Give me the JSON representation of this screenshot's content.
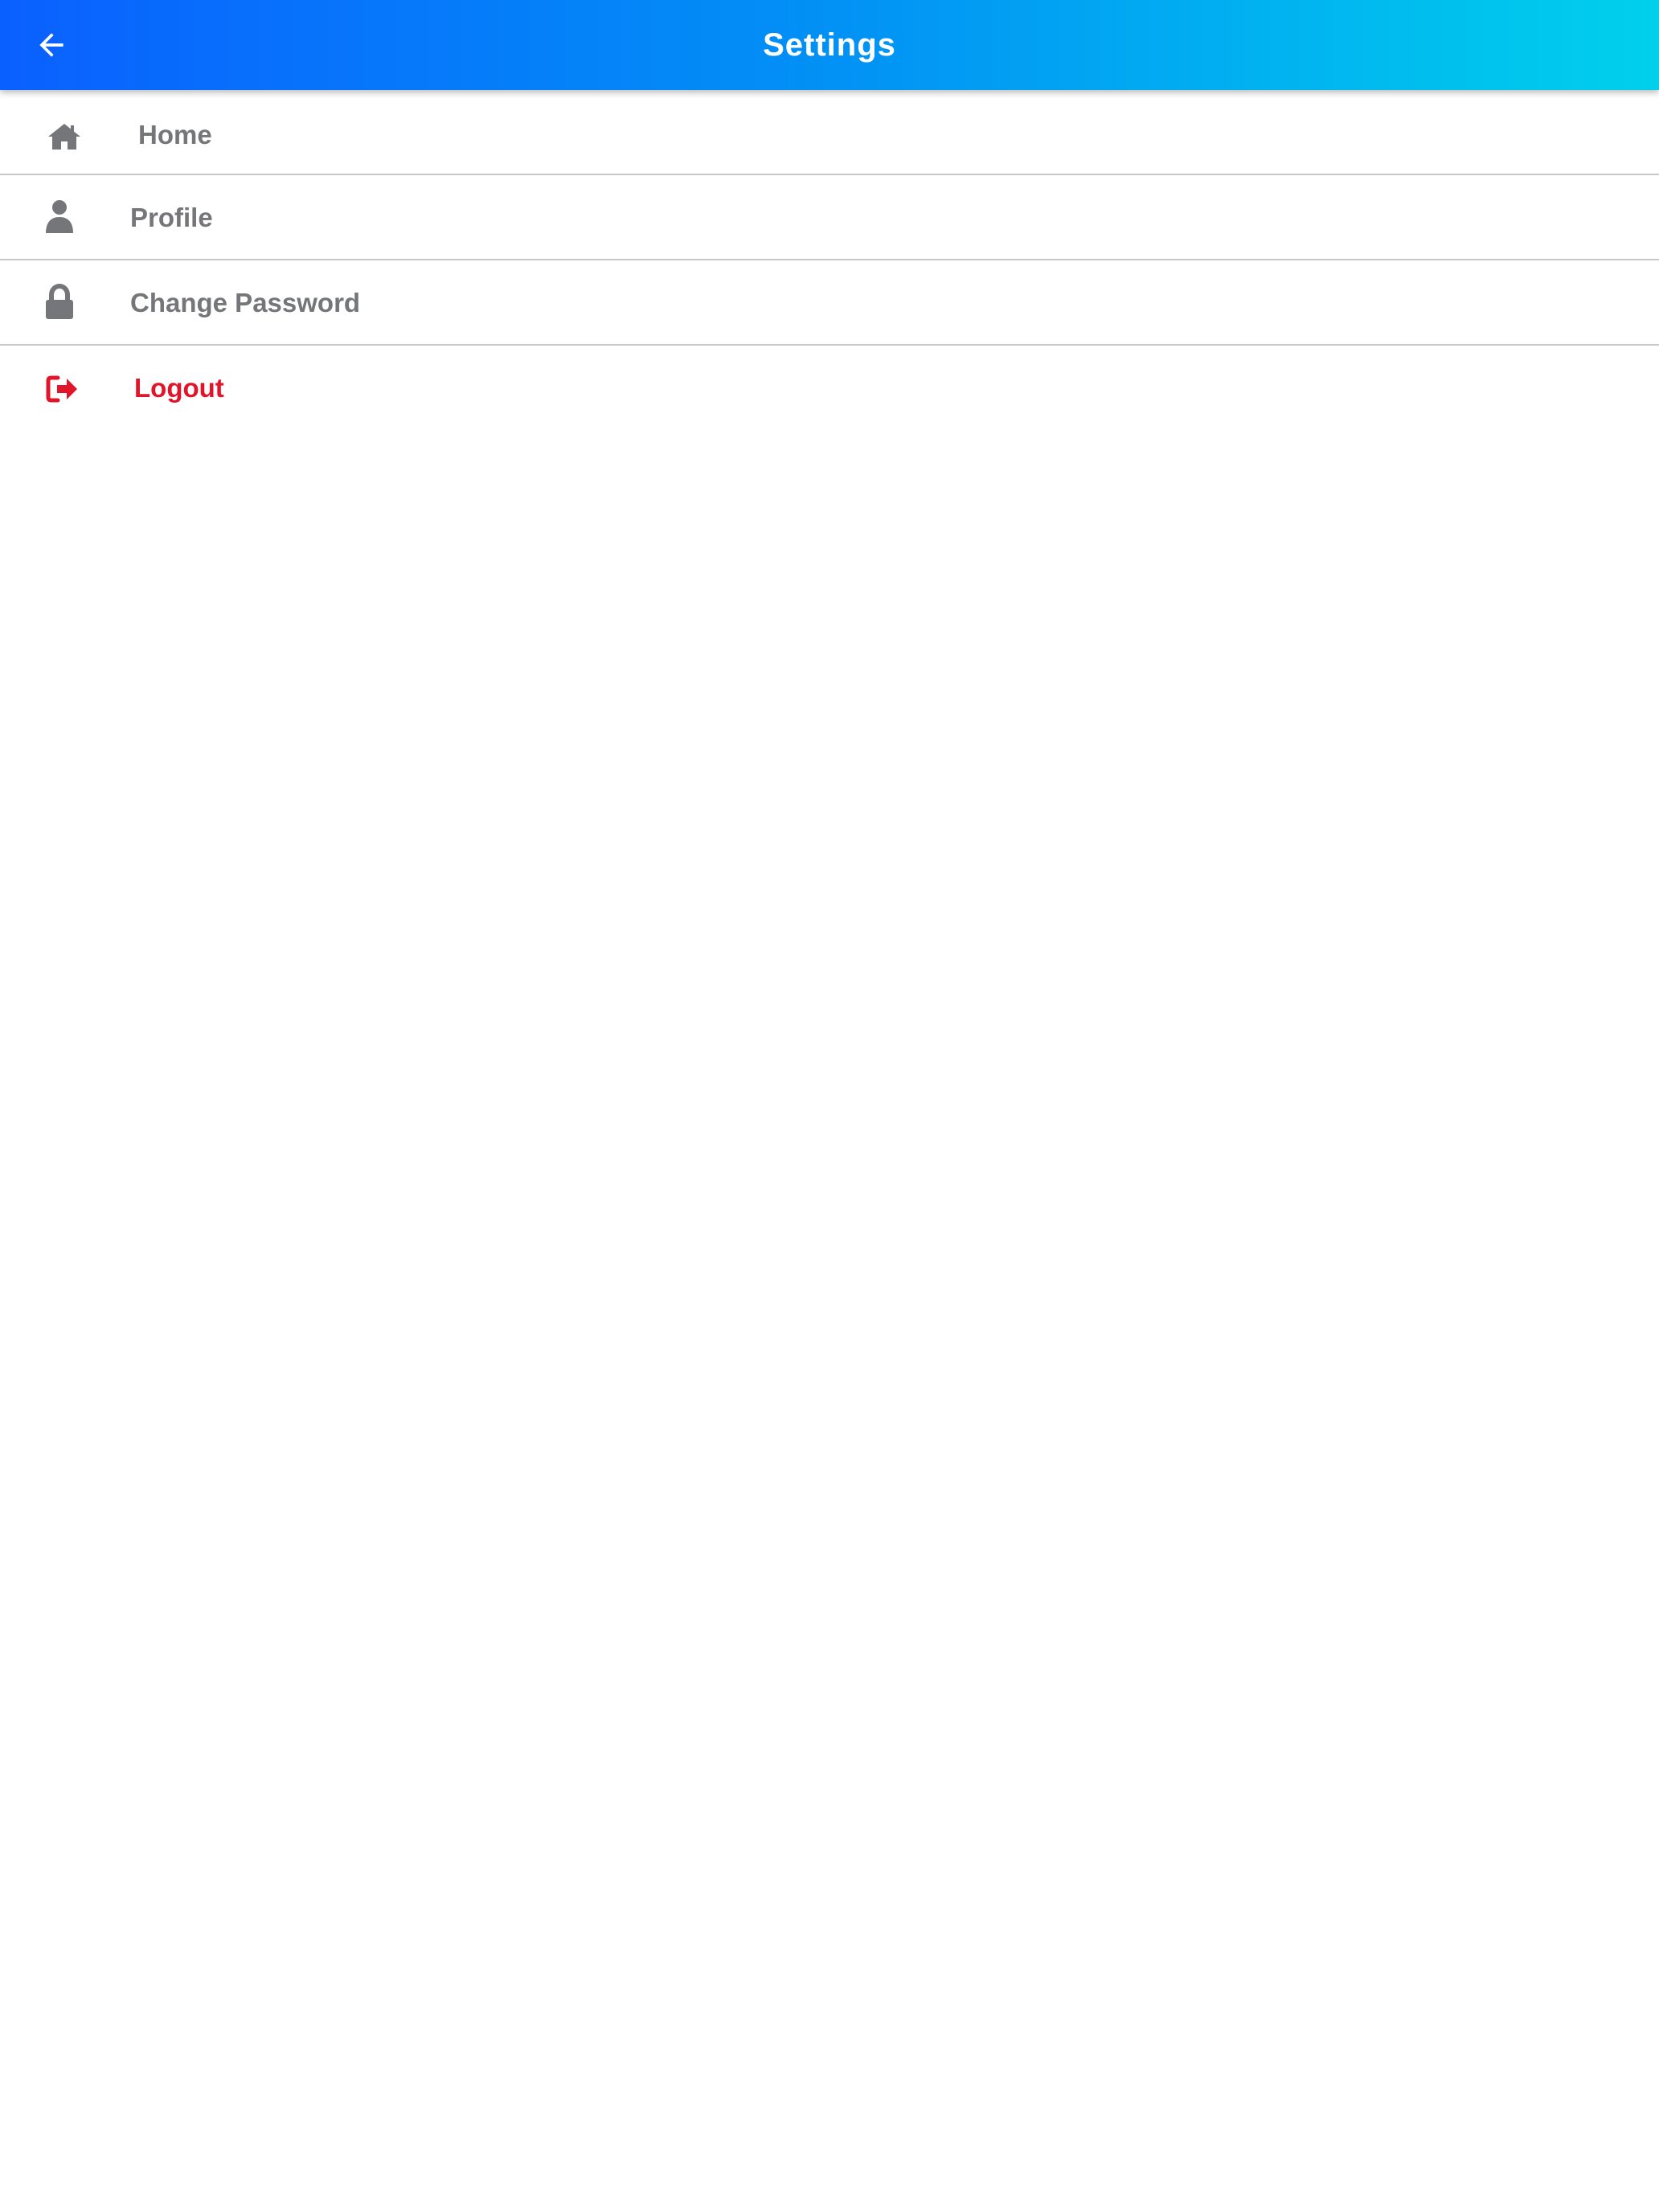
{
  "appbar": {
    "title": "Settings",
    "back_icon": "arrow-left-icon",
    "gradient": [
      "#0a60ff",
      "#00d0ec"
    ]
  },
  "menu": {
    "items": [
      {
        "label": "Home",
        "icon": "home-icon"
      },
      {
        "label": "Profile",
        "icon": "user-icon"
      },
      {
        "label": "Change Password",
        "icon": "lock-icon"
      },
      {
        "label": "Logout",
        "icon": "logout-icon",
        "color": "#e0152a"
      }
    ]
  },
  "colors": {
    "text_muted": "#75767a",
    "danger": "#e0152a",
    "divider": "#c8c8c8"
  }
}
